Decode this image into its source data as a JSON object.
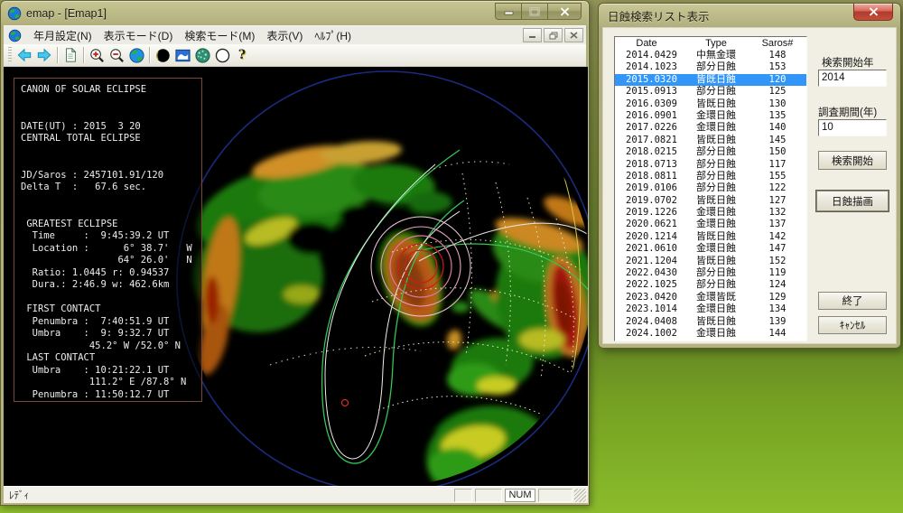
{
  "desktop": {
    "icon_colors": [
      "#1f4a6a",
      "#2f74d0",
      "#cc3138",
      "#4fb2e8"
    ]
  },
  "colors": {
    "selection_blue": "#3296f8",
    "desktop_green": "#7aa824",
    "titlebar_olive": "#b2b07c",
    "info_panel_border": "#7c4a34",
    "map_background": "#000000",
    "close_button_red": "#b13a2b"
  },
  "main_window": {
    "title": "emap - [Emap1]",
    "menu_items": [
      "年月設定(N)",
      "表示モード(D)",
      "検索モード(M)",
      "表示(V)",
      "ﾍﾙﾌﾟ(H)"
    ],
    "toolbar": {
      "icons": [
        "back-arrow",
        "forward-arrow",
        "new-document",
        "zoom-in",
        "zoom-out",
        "globe",
        "new-moon",
        "map",
        "moon-globe",
        "white-circle",
        "help"
      ],
      "help_glyph": "?"
    },
    "info_panel_lines": [
      "CANON OF SOLAR ECLIPSE",
      "",
      "",
      "DATE(UT) : 2015  3 20",
      "CENTRAL TOTAL ECLIPSE",
      "",
      "",
      "JD/Saros : 2457101.91/120",
      "Delta T  :   67.6 sec.",
      "",
      "",
      " GREATEST ECLIPSE",
      "  Time     :  9:45:39.2 UT",
      "  Location :      6° 38.7'   W",
      "                 64° 26.0'   N",
      "  Ratio: 1.0445 r: 0.94537",
      "  Dura.: 2:46.9 w: 462.6km",
      "",
      " FIRST CONTACT",
      "  Penumbra :  7:40:51.9 UT",
      "  Umbra    :  9: 9:32.7 UT",
      "            45.2° W /52.0° N",
      " LAST CONTACT",
      "  Umbra    : 10:21:22.1 UT",
      "            111.2° E /87.8° N",
      "  Penumbra : 11:50:12.7 UT"
    ],
    "status_bar": {
      "ready_text": "ﾚﾃﾞｨ",
      "num_indicator": "NUM"
    }
  },
  "dialog": {
    "title": "日蝕検索リスト表示",
    "list": {
      "headers": [
        "Date",
        "Type",
        "Saros#"
      ],
      "selected_index": 2,
      "rows": [
        [
          "2014.0429",
          "中無金環",
          "148"
        ],
        [
          "2014.1023",
          "部分日蝕",
          "153"
        ],
        [
          "2015.0320",
          "皆既日蝕",
          "120"
        ],
        [
          "2015.0913",
          "部分日蝕",
          "125"
        ],
        [
          "2016.0309",
          "皆既日蝕",
          "130"
        ],
        [
          "2016.0901",
          "金環日蝕",
          "135"
        ],
        [
          "2017.0226",
          "金環日蝕",
          "140"
        ],
        [
          "2017.0821",
          "皆既日蝕",
          "145"
        ],
        [
          "2018.0215",
          "部分日蝕",
          "150"
        ],
        [
          "2018.0713",
          "部分日蝕",
          "117"
        ],
        [
          "2018.0811",
          "部分日蝕",
          "155"
        ],
        [
          "2019.0106",
          "部分日蝕",
          "122"
        ],
        [
          "2019.0702",
          "皆既日蝕",
          "127"
        ],
        [
          "2019.1226",
          "金環日蝕",
          "132"
        ],
        [
          "2020.0621",
          "金環日蝕",
          "137"
        ],
        [
          "2020.1214",
          "皆既日蝕",
          "142"
        ],
        [
          "2021.0610",
          "金環日蝕",
          "147"
        ],
        [
          "2021.1204",
          "皆既日蝕",
          "152"
        ],
        [
          "2022.0430",
          "部分日蝕",
          "119"
        ],
        [
          "2022.1025",
          "部分日蝕",
          "124"
        ],
        [
          "2023.0420",
          "金環皆既",
          "129"
        ],
        [
          "2023.1014",
          "金環日蝕",
          "134"
        ],
        [
          "2024.0408",
          "皆既日蝕",
          "139"
        ],
        [
          "2024.1002",
          "金環日蝕",
          "144"
        ]
      ]
    },
    "search_start_year": {
      "label": "検索開始年",
      "value": "2014"
    },
    "survey_period": {
      "label": "調査期間(年)",
      "value": "10"
    },
    "buttons": {
      "search": "検索開始",
      "draw": "日蝕描画",
      "exit": "終了",
      "cancel": "ｷｬﾝｾﾙ"
    }
  }
}
